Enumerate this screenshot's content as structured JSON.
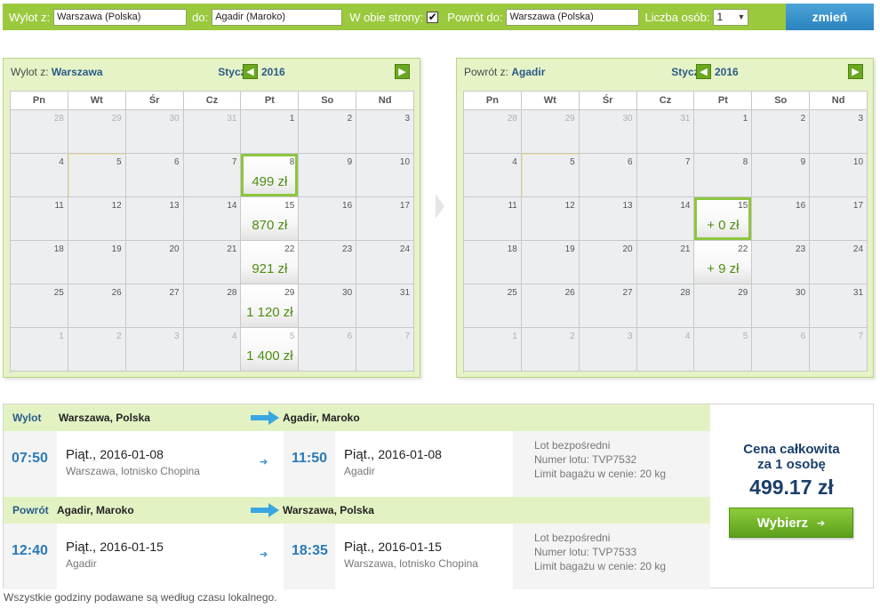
{
  "search": {
    "from_label": "Wylot z:",
    "from_value": "Warszawa (Polska)",
    "to_label": "do:",
    "to_value": "Agadir (Maroko)",
    "roundtrip_label": "W obie strony:",
    "roundtrip_checked": true,
    "return_label": "Powrót do:",
    "return_value": "Warszawa (Polska)",
    "pax_label": "Liczba osób:",
    "pax_value": "1",
    "submit_label": "zmień"
  },
  "weekdays": [
    "Pn",
    "Wt",
    "Śr",
    "Cz",
    "Pt",
    "So",
    "Nd"
  ],
  "calendars": [
    {
      "direction_prefix": "Wylot z:",
      "direction_city": "Warszawa",
      "month": "Styczeń 2016",
      "weeks": [
        [
          {
            "d": "28",
            "o": true
          },
          {
            "d": "29",
            "o": true
          },
          {
            "d": "30",
            "o": true
          },
          {
            "d": "31",
            "o": true
          },
          {
            "d": "1"
          },
          {
            "d": "2"
          },
          {
            "d": "3"
          }
        ],
        [
          {
            "d": "4"
          },
          {
            "d": "5",
            "today": true
          },
          {
            "d": "6"
          },
          {
            "d": "7"
          },
          {
            "d": "8",
            "p": "499 zł",
            "sel": true
          },
          {
            "d": "9"
          },
          {
            "d": "10"
          }
        ],
        [
          {
            "d": "11"
          },
          {
            "d": "12"
          },
          {
            "d": "13"
          },
          {
            "d": "14"
          },
          {
            "d": "15",
            "p": "870 zł"
          },
          {
            "d": "16"
          },
          {
            "d": "17"
          }
        ],
        [
          {
            "d": "18"
          },
          {
            "d": "19"
          },
          {
            "d": "20"
          },
          {
            "d": "21"
          },
          {
            "d": "22",
            "p": "921 zł"
          },
          {
            "d": "23"
          },
          {
            "d": "24"
          }
        ],
        [
          {
            "d": "25"
          },
          {
            "d": "26"
          },
          {
            "d": "27"
          },
          {
            "d": "28"
          },
          {
            "d": "29",
            "p": "1 120 zł"
          },
          {
            "d": "30"
          },
          {
            "d": "31"
          }
        ],
        [
          {
            "d": "1",
            "o": true
          },
          {
            "d": "2",
            "o": true
          },
          {
            "d": "3",
            "o": true
          },
          {
            "d": "4",
            "o": true
          },
          {
            "d": "5",
            "o": true,
            "p": "1 400 zł"
          },
          {
            "d": "6",
            "o": true
          },
          {
            "d": "7",
            "o": true
          }
        ]
      ]
    },
    {
      "direction_prefix": "Powrót z:",
      "direction_city": "Agadir",
      "month": "Styczeń 2016",
      "weeks": [
        [
          {
            "d": "28",
            "o": true
          },
          {
            "d": "29",
            "o": true
          },
          {
            "d": "30",
            "o": true
          },
          {
            "d": "31",
            "o": true
          },
          {
            "d": "1"
          },
          {
            "d": "2"
          },
          {
            "d": "3"
          }
        ],
        [
          {
            "d": "4"
          },
          {
            "d": "5",
            "today": true
          },
          {
            "d": "6"
          },
          {
            "d": "7"
          },
          {
            "d": "8"
          },
          {
            "d": "9"
          },
          {
            "d": "10"
          }
        ],
        [
          {
            "d": "11"
          },
          {
            "d": "12"
          },
          {
            "d": "13"
          },
          {
            "d": "14"
          },
          {
            "d": "15",
            "p": "+ 0 zł",
            "sel": true
          },
          {
            "d": "16"
          },
          {
            "d": "17"
          }
        ],
        [
          {
            "d": "18"
          },
          {
            "d": "19"
          },
          {
            "d": "20"
          },
          {
            "d": "21"
          },
          {
            "d": "22",
            "p": "+ 9 zł"
          },
          {
            "d": "23"
          },
          {
            "d": "24"
          }
        ],
        [
          {
            "d": "25"
          },
          {
            "d": "26"
          },
          {
            "d": "27"
          },
          {
            "d": "28"
          },
          {
            "d": "29"
          },
          {
            "d": "30"
          },
          {
            "d": "31"
          }
        ],
        [
          {
            "d": "1",
            "o": true
          },
          {
            "d": "2",
            "o": true
          },
          {
            "d": "3",
            "o": true
          },
          {
            "d": "4",
            "o": true
          },
          {
            "d": "5",
            "o": true
          },
          {
            "d": "6",
            "o": true
          },
          {
            "d": "7",
            "o": true
          }
        ]
      ]
    }
  ],
  "segments": [
    {
      "tag": "Wylot",
      "from": "Warszawa, Polska",
      "to": "Agadir, Maroko",
      "dep_time": "07:50",
      "dep_day": "Piąt.,",
      "dep_date": "2016-01-08",
      "dep_place": "Warszawa, lotnisko Chopina",
      "arr_time": "11:50",
      "arr_day": "Piąt.,",
      "arr_date": "2016-01-08",
      "arr_place": "Agadir",
      "info1": "Lot bezpośredni",
      "info2": "Numer lotu: TVP7532",
      "info3": "Limit bagażu w cenie: 20 kg"
    },
    {
      "tag": "Powrót",
      "from": "Agadir, Maroko",
      "to": "Warszawa, Polska",
      "dep_time": "12:40",
      "dep_day": "Piąt.,",
      "dep_date": "2016-01-15",
      "dep_place": "Agadir",
      "arr_time": "18:35",
      "arr_day": "Piąt.,",
      "arr_date": "2016-01-15",
      "arr_place": "Warszawa, lotnisko Chopina",
      "info1": "Lot bezpośredni",
      "info2": "Numer lotu: TVP7533",
      "info3": "Limit bagażu w cenie: 20 kg"
    }
  ],
  "price": {
    "label_line1": "Cena całkowita",
    "label_line2": "za 1 osobę",
    "amount": "499.17 zł",
    "button": "Wybierz"
  },
  "footnote": "Wszystkie godziny podawane są według czasu lokalnego.",
  "colors": {
    "bar_green": "#9bc93e",
    "price_green": "#4f8d12",
    "link_blue": "#2a7ab8",
    "navy": "#1a3f6b"
  }
}
